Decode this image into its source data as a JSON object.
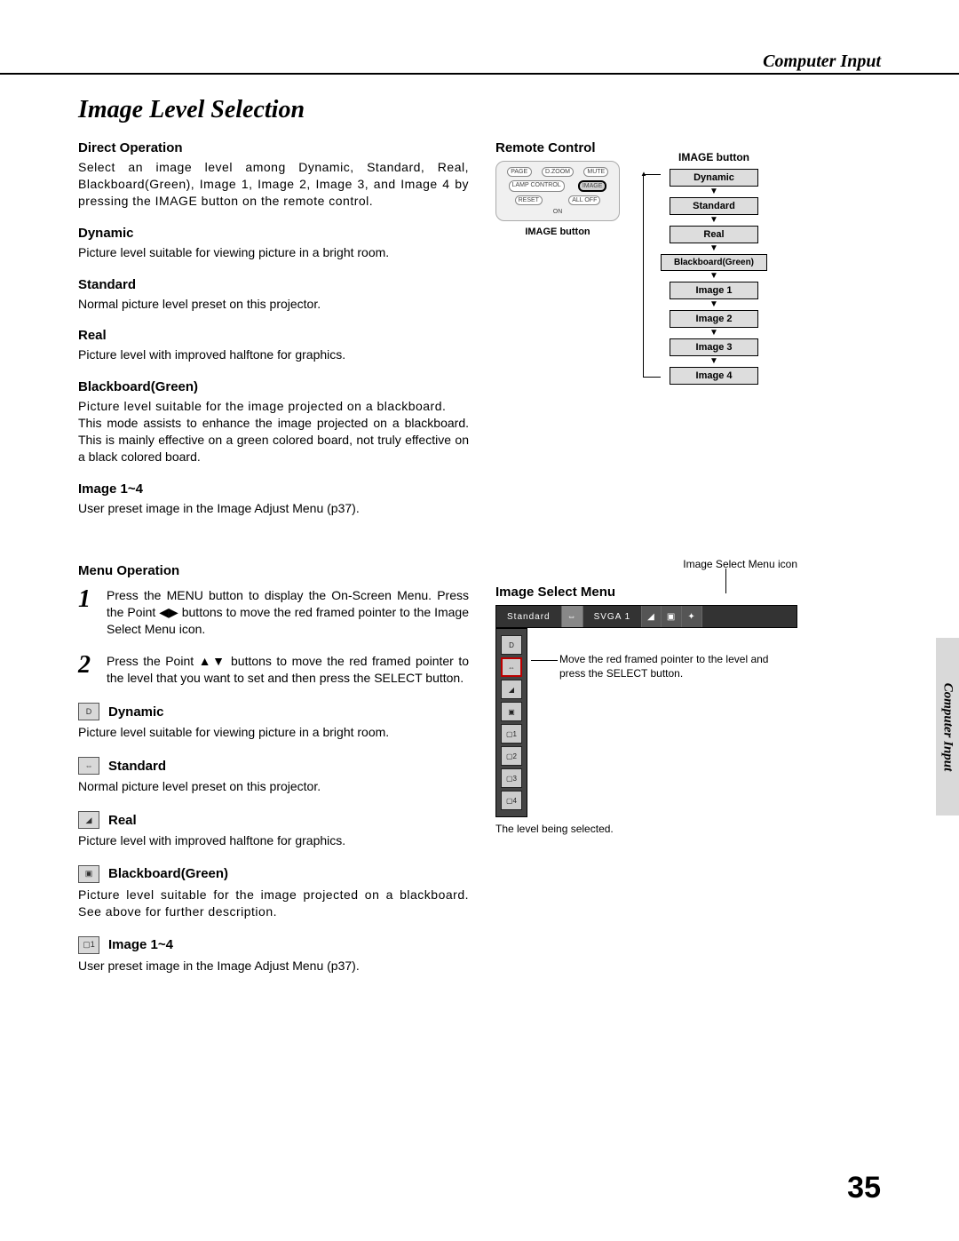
{
  "header": {
    "section": "Computer Input"
  },
  "title": "Image Level Selection",
  "direct": {
    "heading": "Direct Operation",
    "intro": "Select an image level among Dynamic, Standard, Real, Blackboard(Green), Image 1, Image 2, Image 3, and Image 4 by pressing the IMAGE button on the remote control.",
    "items": [
      {
        "name": "Dynamic",
        "desc": "Picture level suitable for viewing picture in a bright room."
      },
      {
        "name": "Standard",
        "desc": "Normal picture level preset on this projector."
      },
      {
        "name": "Real",
        "desc": "Picture level with improved halftone for graphics."
      },
      {
        "name": "Blackboard(Green)",
        "desc": "Picture level suitable for the image projected on a blackboard.",
        "desc2": "This mode assists to enhance the image projected on a blackboard.  This is mainly effective on a green colored board, not truly effective on a black colored board."
      },
      {
        "name": "Image 1~4",
        "desc": "User preset image in the Image Adjust Menu (p37)."
      }
    ]
  },
  "menu": {
    "heading": "Menu Operation",
    "steps": [
      "Press the MENU button to display the On-Screen Menu.  Press the Point ◀▶ buttons to move the red framed pointer to the Image Select Menu icon.",
      "Press the Point ▲▼ buttons to move the red framed pointer to the level that you want to set and then press the SELECT button."
    ],
    "items": [
      {
        "name": "Dynamic",
        "desc": "Picture level suitable for viewing picture in a bright room."
      },
      {
        "name": "Standard",
        "desc": "Normal picture level preset on this projector."
      },
      {
        "name": "Real",
        "desc": "Picture level with improved halftone for graphics."
      },
      {
        "name": "Blackboard(Green)",
        "desc": "Picture level suitable for the image projected on a blackboard.   See above for further description."
      },
      {
        "name": "Image 1~4",
        "desc": "User preset image in the Image Adjust Menu (p37)."
      }
    ]
  },
  "remote": {
    "heading": "Remote Control",
    "buttons": [
      "PAGE",
      "D.ZOOM",
      "MUTE",
      "LAMP CONTROL",
      "IMAGE",
      "RESET",
      "ALL OFF",
      "ON"
    ],
    "caption": "IMAGE button",
    "flow_title": "IMAGE button",
    "flow": [
      "Dynamic",
      "Standard",
      "Real",
      "Blackboard(Green)",
      "Image 1",
      "Image 2",
      "Image 3",
      "Image 4"
    ]
  },
  "ism": {
    "icon_caption": "Image Select Menu icon",
    "heading": "Image Select Menu",
    "bar_label": "Standard",
    "bar_mode": "SVGA 1",
    "pointer_note": "Move the red framed pointer to the level and press the SELECT button.",
    "selected_note": "The level being selected.",
    "vitems": [
      "D",
      "⇔",
      "◢",
      "▣",
      "▢1",
      "▢2",
      "▢3",
      "▢4"
    ]
  },
  "side_tab": "Computer Input",
  "page_number": "35"
}
